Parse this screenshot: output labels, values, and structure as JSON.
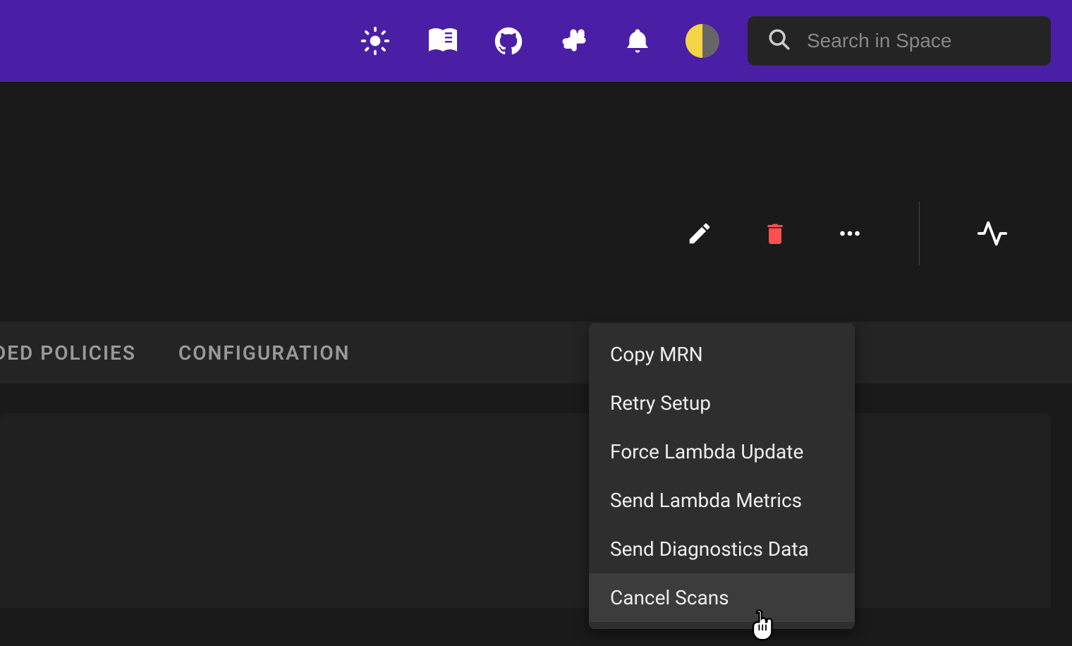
{
  "search": {
    "placeholder": "Search in Space"
  },
  "tabs": [
    {
      "label": "DED POLICIES"
    },
    {
      "label": "CONFIGURATION"
    }
  ],
  "icons": {
    "brightness": "brightness-icon",
    "book": "book-icon",
    "github": "github-icon",
    "slack": "slack-icon",
    "bell": "bell-icon",
    "theme": "theme-toggle-icon",
    "search": "search-icon",
    "edit": "edit-icon",
    "delete": "delete-icon",
    "more": "more-icon",
    "activity": "activity-icon"
  },
  "menu": {
    "items": [
      {
        "label": "Copy MRN"
      },
      {
        "label": "Retry Setup"
      },
      {
        "label": "Force Lambda Update"
      },
      {
        "label": "Send Lambda Metrics"
      },
      {
        "label": "Send Diagnostics Data"
      },
      {
        "label": "Cancel Scans",
        "hovered": true
      }
    ]
  },
  "colors": {
    "topbar": "#4a1fa5",
    "delete": "#ff4f4f",
    "background": "#1a1a1a"
  }
}
